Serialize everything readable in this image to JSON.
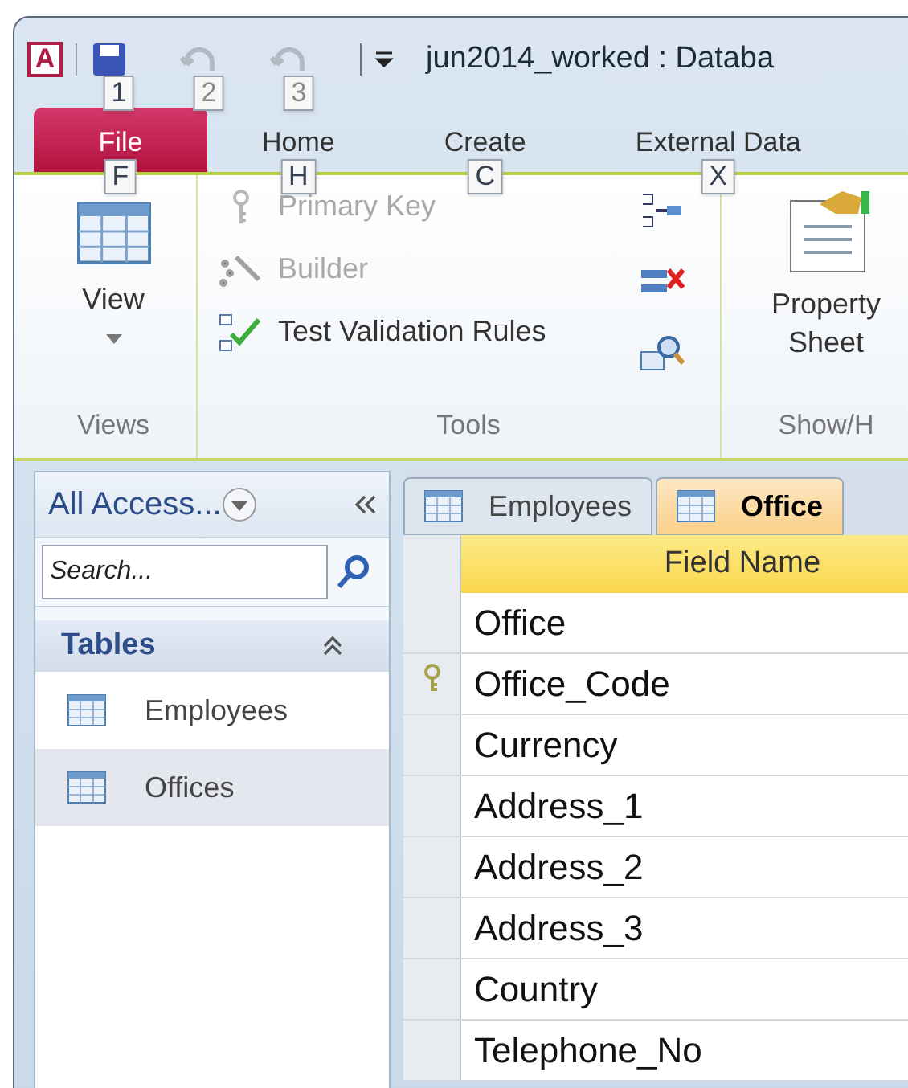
{
  "window": {
    "title": "jun2014_worked : Databa",
    "app_logo": "A"
  },
  "quick_access": [
    {
      "key_tip": "1",
      "disabled": false
    },
    {
      "key_tip": "2",
      "disabled": true
    },
    {
      "key_tip": "3",
      "disabled": true
    }
  ],
  "ribbon_tabs": [
    {
      "label": "File",
      "key_tip": "F",
      "kind": "file"
    },
    {
      "label": "Home",
      "key_tip": "H",
      "kind": "tab"
    },
    {
      "label": "Create",
      "key_tip": "C",
      "kind": "tab"
    },
    {
      "label": "External Data",
      "key_tip": "X",
      "kind": "tab"
    }
  ],
  "ribbon": {
    "views": {
      "button": "View",
      "label": "Views"
    },
    "tools": {
      "label": "Tools",
      "commands": [
        {
          "label": "Primary Key",
          "disabled": true
        },
        {
          "label": "Builder",
          "disabled": true
        },
        {
          "label": "Test Validation Rules",
          "disabled": false
        }
      ]
    },
    "show_hide": {
      "button": "Property Sheet",
      "label": "Show/H"
    }
  },
  "nav_pane": {
    "title": "All Access...",
    "search": {
      "placeholder": "Search..."
    },
    "group": {
      "label": "Tables",
      "expanded": true,
      "items": [
        {
          "label": "Employees",
          "selected": false
        },
        {
          "label": "Offices",
          "selected": true
        }
      ]
    }
  },
  "doc_tabs": [
    {
      "label": "Employees",
      "selected": false
    },
    {
      "label": "Office",
      "selected": true
    }
  ],
  "design_grid": {
    "columns": [
      "Field Name"
    ],
    "rows": [
      {
        "field": "Office",
        "primary_key": false
      },
      {
        "field": "Office_Code",
        "primary_key": true
      },
      {
        "field": "Currency",
        "primary_key": false
      },
      {
        "field": "Address_1",
        "primary_key": false
      },
      {
        "field": "Address_2",
        "primary_key": false
      },
      {
        "field": "Address_3",
        "primary_key": false
      },
      {
        "field": "Country",
        "primary_key": false
      },
      {
        "field": "Telephone_No",
        "primary_key": false
      }
    ]
  }
}
